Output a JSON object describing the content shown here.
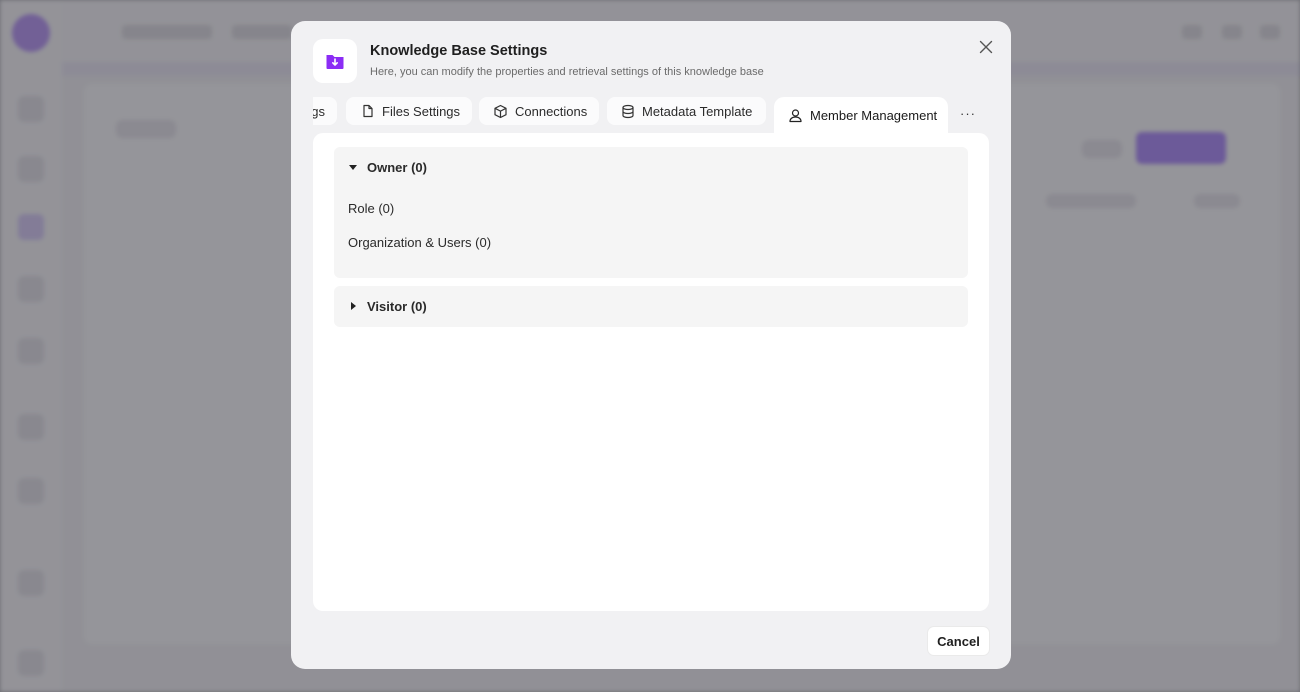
{
  "dialog": {
    "title": "Knowledge Base Settings",
    "subtitle": "Here, you can modify the properties and retrieval settings of this knowledge base",
    "header_icon": "folder-download-icon",
    "accent_color": "#8b2cf5"
  },
  "tabs": [
    {
      "label": "gs",
      "icon": "none",
      "active": false
    },
    {
      "label": "Files Settings",
      "icon": "file-icon",
      "active": false
    },
    {
      "label": "Connections",
      "icon": "cube-icon",
      "active": false
    },
    {
      "label": "Metadata Template",
      "icon": "database-icon",
      "active": false
    },
    {
      "label": "Member Management",
      "icon": "user-icon",
      "active": true
    }
  ],
  "more_label": "···",
  "members": {
    "owner": {
      "title": "Owner (0)",
      "expanded": true,
      "items": [
        "Role (0)",
        "Organization & Users (0)"
      ]
    },
    "visitor": {
      "title": "Visitor (0)",
      "expanded": false
    }
  },
  "footer": {
    "cancel_label": "Cancel"
  }
}
